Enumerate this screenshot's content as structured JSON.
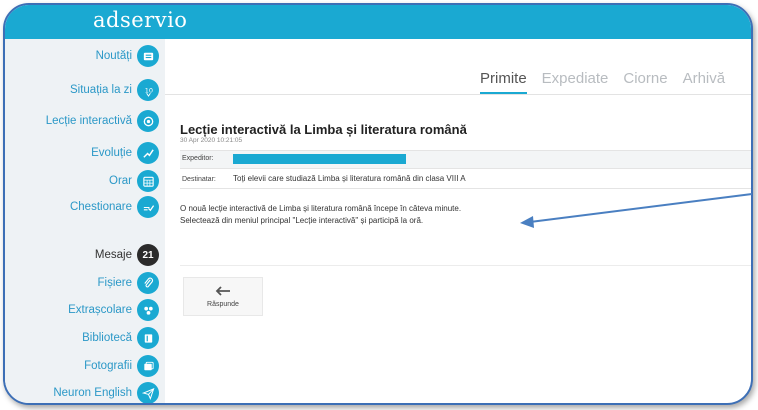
{
  "app": {
    "logo": "adservio"
  },
  "sidebar": {
    "items": [
      {
        "label": "Noutăți",
        "icon": "news-icon"
      },
      {
        "label": "Situația la zi",
        "icon": "grade-icon"
      },
      {
        "label": "Lecție interactivă",
        "icon": "interactive-lesson-icon"
      },
      {
        "label": "Evoluție",
        "icon": "trend-chart-icon"
      },
      {
        "label": "Orar",
        "icon": "calendar-icon"
      },
      {
        "label": "Chestionare",
        "icon": "survey-icon"
      },
      {
        "label": "Mesaje",
        "badge": "21"
      },
      {
        "label": "Fișiere",
        "icon": "paperclip-icon"
      },
      {
        "label": "Extrașcolare",
        "icon": "activities-icon"
      },
      {
        "label": "Bibliotecă",
        "icon": "book-icon"
      },
      {
        "label": "Fotografii",
        "icon": "photos-icon"
      },
      {
        "label": "Neuron English",
        "icon": "paper-plane-icon"
      }
    ]
  },
  "tabs": [
    {
      "label": "Primite",
      "active": true
    },
    {
      "label": "Expediate",
      "active": false
    },
    {
      "label": "Ciorne",
      "active": false
    },
    {
      "label": "Arhivă",
      "active": false
    }
  ],
  "message": {
    "title": "Lecție interactivă la Limba și literatura română",
    "date": "30 Apr 2020 10:21:05",
    "sender_label": "Expeditor:",
    "recipient_label": "Destinatar:",
    "recipients": "Toți elevii care studiază Limba și literatura română din clasa VIII A",
    "body_line1": "O nouă lecție interactivă de Limba și literatura română începe în câteva minute.",
    "body_line2": "Selectează din meniul principal \"Lecție interactivă\" și participă la oră."
  },
  "actions": {
    "reply_label": "Răspunde"
  },
  "colors": {
    "accent": "#1aa9d2",
    "frame": "#3d6fb6",
    "sidebar_bg": "#eef2f5",
    "badge": "#2b2b2b"
  }
}
